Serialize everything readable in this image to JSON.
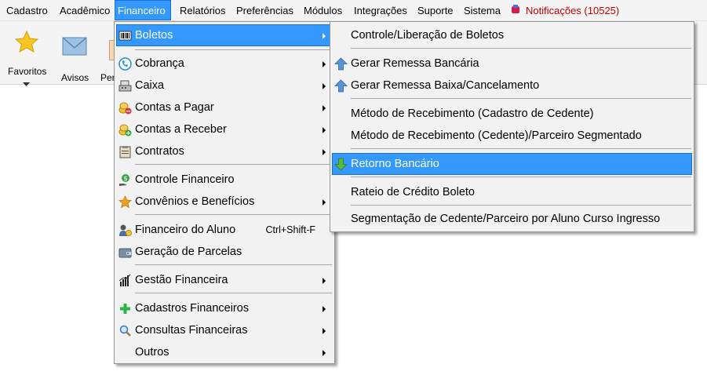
{
  "menubar": {
    "items": [
      "Cadastro",
      "Acadêmico",
      "Financeiro",
      "Relatórios",
      "Preferências",
      "Módulos",
      "Integrações",
      "Suporte",
      "Sistema"
    ],
    "active": "Financeiro",
    "notifications": "Notificações (10525)"
  },
  "toolbar": {
    "favoritos": "Favoritos",
    "avisos": "Avisos",
    "partial": "Per"
  },
  "financeiro_menu": {
    "items": [
      {
        "label": "Boletos",
        "icon": "barcode-icon",
        "submenu": true
      },
      {
        "label": "Cobrança",
        "icon": "phone-icon",
        "submenu": true
      },
      {
        "label": "Caixa",
        "icon": "cash-register-icon",
        "submenu": true
      },
      {
        "label": "Contas a Pagar",
        "icon": "coins-minus-icon",
        "submenu": true
      },
      {
        "label": "Contas a Receber",
        "icon": "coins-plus-icon",
        "submenu": true
      },
      {
        "label": "Contratos",
        "icon": "clipboard-icon",
        "submenu": true
      },
      {
        "label": "Controle Financeiro",
        "icon": "money-hand-icon",
        "submenu": false
      },
      {
        "label": "Convênios e Benefícios",
        "icon": "star-icon",
        "submenu": true
      },
      {
        "label": "Financeiro do Aluno",
        "icon": "student-money-icon",
        "submenu": false,
        "shortcut": "Ctrl+Shift-F"
      },
      {
        "label": "Geração de Parcelas",
        "icon": "wallet-icon",
        "submenu": false
      },
      {
        "label": "Gestão Financeira",
        "icon": "bar-chart-icon",
        "submenu": true
      },
      {
        "label": "Cadastros Financeiros",
        "icon": "green-plus-icon",
        "submenu": true
      },
      {
        "label": "Consultas Financeiras",
        "icon": "magnifier-icon",
        "submenu": true
      },
      {
        "label": "Outros",
        "icon": "",
        "submenu": true
      }
    ]
  },
  "boletos_menu": {
    "items": [
      {
        "label": "Controle/Liberação de Boletos",
        "icon": ""
      },
      {
        "label": "Gerar Remessa Bancária",
        "icon": "upload-arrow-icon"
      },
      {
        "label": "Gerar Remessa Baixa/Cancelamento",
        "icon": "upload-arrow-icon"
      },
      {
        "label": "Método de Recebimento (Cadastro de Cedente)",
        "icon": ""
      },
      {
        "label": "Método de Recebimento (Cedente)/Parceiro Segmentado",
        "icon": ""
      },
      {
        "label": "Retorno Bancário",
        "icon": "download-arrow-icon"
      },
      {
        "label": "Rateio de Crédito Boleto",
        "icon": ""
      },
      {
        "label": "Segmentação de Cedente/Parceiro por Aluno Curso Ingresso",
        "icon": ""
      }
    ],
    "highlighted": "Retorno Bancário"
  },
  "colors": {
    "highlight": "#3399ff",
    "notifications": "#c40000"
  }
}
